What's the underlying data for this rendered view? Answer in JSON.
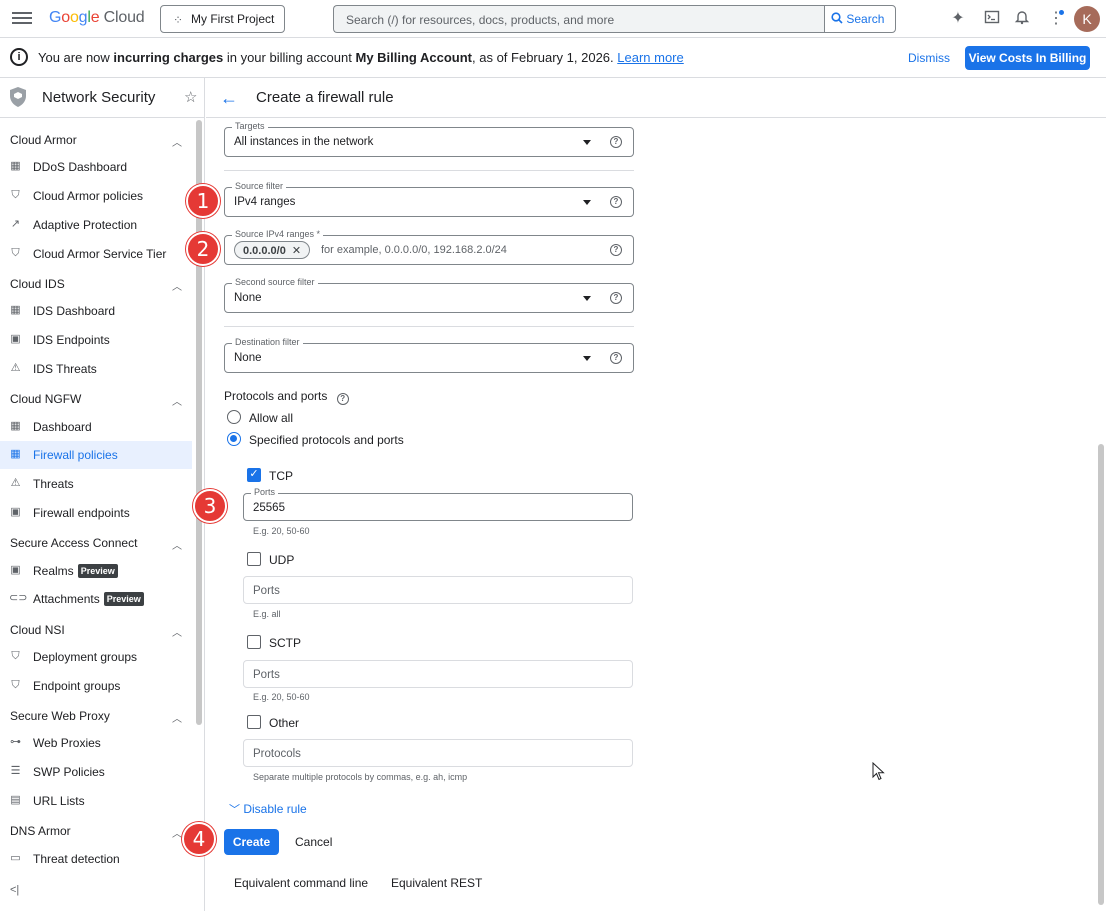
{
  "topbar": {
    "logo": {
      "g": "G",
      "o1": "o",
      "o2": "o",
      "g2": "g",
      "l": "l",
      "e": "e",
      "cloud": "Cloud"
    },
    "project": "My First Project",
    "search_placeholder": "Search (/) for resources, docs, products, and more",
    "search_button": "Search",
    "avatar_letter": "K"
  },
  "banner": {
    "text_1": "You are now ",
    "text_bold_1": "incurring charges",
    "text_2": " in your billing account ",
    "text_bold_2": "My Billing Account",
    "text_3": ", as of February 1, 2026. ",
    "learn_more": "Learn more",
    "dismiss": "Dismiss",
    "view_costs": "View Costs In Billing"
  },
  "sidebar": {
    "title": "Network Security",
    "sections": [
      {
        "label": "Cloud Armor"
      },
      {
        "label": "Cloud IDS"
      },
      {
        "label": "Cloud NGFW"
      },
      {
        "label": "Secure Access Connect"
      },
      {
        "label": "Cloud NSI"
      },
      {
        "label": "Secure Web Proxy"
      },
      {
        "label": "DNS Armor"
      }
    ],
    "items": [
      {
        "label": "DDoS Dashboard"
      },
      {
        "label": "Cloud Armor policies"
      },
      {
        "label": "Adaptive Protection"
      },
      {
        "label": "Cloud Armor Service Tier"
      },
      {
        "label": "IDS Dashboard"
      },
      {
        "label": "IDS Endpoints"
      },
      {
        "label": "IDS Threats"
      },
      {
        "label": "Dashboard"
      },
      {
        "label": "Firewall policies"
      },
      {
        "label": "Threats"
      },
      {
        "label": "Firewall endpoints"
      },
      {
        "label": "Realms",
        "badge": "Preview"
      },
      {
        "label": "Attachments",
        "badge": "Preview"
      },
      {
        "label": "Deployment groups"
      },
      {
        "label": "Endpoint groups"
      },
      {
        "label": "Web Proxies"
      },
      {
        "label": "SWP Policies"
      },
      {
        "label": "URL Lists"
      },
      {
        "label": "Threat detection"
      }
    ]
  },
  "page": {
    "title": "Create a firewall rule"
  },
  "form": {
    "targets": {
      "label": "Targets",
      "value": "All instances in the network"
    },
    "source_filter": {
      "label": "Source filter",
      "value": "IPv4 ranges"
    },
    "source_ranges": {
      "label": "Source IPv4 ranges *",
      "chip": "0.0.0.0/0",
      "chip_remove": "✕",
      "placeholder": "for example, 0.0.0.0/0, 192.168.2.0/24"
    },
    "second_source_filter": {
      "label": "Second source filter",
      "value": "None"
    },
    "destination_filter": {
      "label": "Destination filter",
      "value": "None"
    },
    "protocols_title": "Protocols and ports",
    "allow_all": "Allow all",
    "specified": "Specified protocols and ports",
    "tcp": {
      "label": "TCP",
      "ports_label": "Ports",
      "ports_value": "25565",
      "hint": "E.g. 20, 50-60"
    },
    "udp": {
      "label": "UDP",
      "ports_placeholder": "Ports",
      "hint": "E.g. all"
    },
    "sctp": {
      "label": "SCTP",
      "ports_placeholder": "Ports",
      "hint": "E.g. 20, 50-60"
    },
    "other": {
      "label": "Other",
      "placeholder": "Protocols",
      "hint": "Separate multiple protocols by commas, e.g. ah, icmp"
    },
    "disable_rule": "Disable rule",
    "create": "Create",
    "cancel": "Cancel",
    "equivalent_cmd": "Equivalent command line",
    "equivalent_rest": "Equivalent REST"
  },
  "steps": [
    "1",
    "2",
    "3",
    "4"
  ],
  "colors": {
    "accent": "#1a73e8",
    "step": "#e53935"
  }
}
